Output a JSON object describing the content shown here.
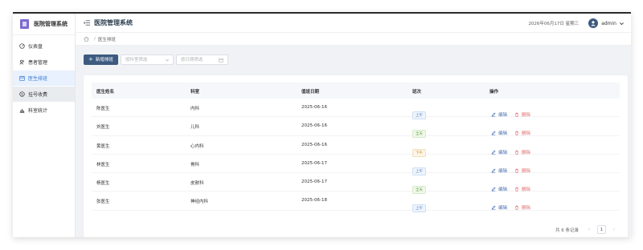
{
  "app": {
    "title": "医院管理系统"
  },
  "sidebar": {
    "items": [
      {
        "label": "仪表盘",
        "icon": "dashboard-icon"
      },
      {
        "label": "患者管理",
        "icon": "users-icon"
      },
      {
        "label": "医生排班",
        "icon": "calendar-icon"
      },
      {
        "label": "挂号收费",
        "icon": "dollar-icon"
      },
      {
        "label": "科室统计",
        "icon": "chart-icon"
      }
    ]
  },
  "header": {
    "title": "医院管理系统",
    "datetime": "2026年06月17日 星期三",
    "username": "admin"
  },
  "breadcrumb": {
    "current": "医生排班",
    "separator": "/"
  },
  "toolbar": {
    "add_label": "新增排班",
    "dept_placeholder": "按科室筛选",
    "date_placeholder": "按日期筛选"
  },
  "table": {
    "headers": [
      "医生姓名",
      "科室",
      "值班日期",
      "班次",
      "操作"
    ],
    "rows": [
      {
        "name": "陈医生",
        "dept": "内科",
        "date": "2025-06-16",
        "shift": "上午",
        "shift_type": "am"
      },
      {
        "name": "刘医生",
        "dept": "儿科",
        "date": "2025-06-16",
        "shift": "全天",
        "shift_type": "all"
      },
      {
        "name": "黄医生",
        "dept": "心内科",
        "date": "2025-06-16",
        "shift": "下午",
        "shift_type": "pm"
      },
      {
        "name": "林医生",
        "dept": "骨科",
        "date": "2025-06-17",
        "shift": "上午",
        "shift_type": "am"
      },
      {
        "name": "杨医生",
        "dept": "皮肤科",
        "date": "2025-06-17",
        "shift": "全天",
        "shift_type": "all"
      },
      {
        "name": "张医生",
        "dept": "神经内科",
        "date": "2025-06-18",
        "shift": "上午",
        "shift_type": "am"
      }
    ],
    "edit_label": "编辑",
    "delete_label": "删除"
  },
  "pagination": {
    "total_text": "共 6 条记录",
    "current_page": "1"
  },
  "colors": {
    "primary": "#3d5a80",
    "active_menu_bg": "#e8f1fd",
    "delete": "#e06b6b"
  }
}
